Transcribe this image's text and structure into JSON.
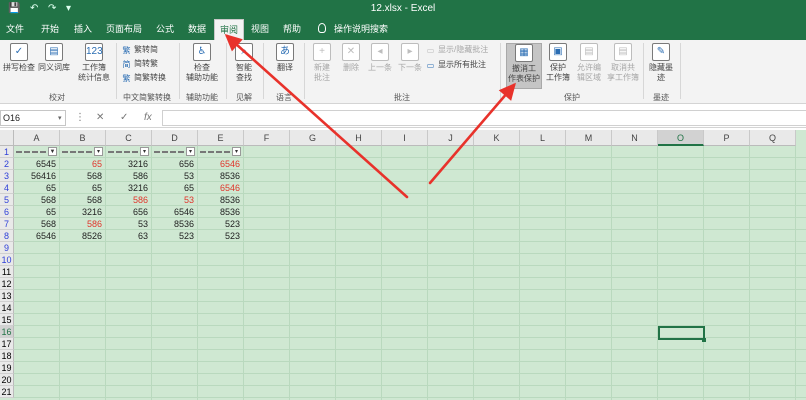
{
  "window": {
    "title": "12.xlsx - Excel",
    "quick_access": [
      "save-icon",
      "undo-icon",
      "redo-icon",
      "customize-icon"
    ],
    "brand_color": "#217346"
  },
  "tabs": [
    {
      "label": "文件"
    },
    {
      "label": "开始"
    },
    {
      "label": "插入"
    },
    {
      "label": "页面布局"
    },
    {
      "label": "公式"
    },
    {
      "label": "数据"
    },
    {
      "label": "审阅",
      "active": true
    },
    {
      "label": "视图"
    },
    {
      "label": "帮助"
    },
    {
      "label": "操作说明搜索"
    }
  ],
  "ribbon": {
    "proofing": {
      "group": "校对",
      "spelling": "拼写检查",
      "thesaurus": "同义词库",
      "stats_line1": "工作簿",
      "stats_line2": "统计信息"
    },
    "chinese": {
      "group": "中文简繁转换",
      "to_simplified": "繁转简",
      "to_traditional": "简转繁",
      "convert": "简繁转换"
    },
    "accessibility": {
      "group": "辅助功能",
      "check_line1": "检查",
      "check_line2": "辅助功能"
    },
    "insights": {
      "group": "见解",
      "smart_line1": "智能",
      "smart_line2": "查找"
    },
    "language": {
      "group": "语言",
      "translate": "翻译"
    },
    "comments": {
      "group": "批注",
      "new_line1": "新建",
      "new_line2": "批注",
      "delete": "删除",
      "previous": "上一条",
      "next": "下一条",
      "show_hide": "显示/隐藏批注",
      "show_all": "显示所有批注"
    },
    "protect": {
      "group": "保护",
      "unprotect_line1": "撤消工",
      "unprotect_line2": "作表保护",
      "protect_wb_line1": "保护",
      "protect_wb_line2": "工作簿",
      "allow_line1": "允许编",
      "allow_line2": "辑区域",
      "unshare_line1": "取消共",
      "unshare_line2": "享工作簿"
    },
    "ink": {
      "group": "墨迹",
      "hide_line1": "隐藏墨",
      "hide_line2": "迹"
    }
  },
  "formula_bar": {
    "name_box": "O16",
    "cancel": "✕",
    "enter": "✓",
    "fx": "fx",
    "value": ""
  },
  "sheet": {
    "columns": [
      "A",
      "B",
      "C",
      "D",
      "E",
      "F",
      "G",
      "H",
      "I",
      "J",
      "K",
      "L",
      "M",
      "N",
      "O",
      "P",
      "Q"
    ],
    "selected_column": "O",
    "rows": [
      "1",
      "2",
      "3",
      "4",
      "5",
      "6",
      "7",
      "8",
      "9",
      "10",
      "11",
      "12",
      "13",
      "14",
      "15",
      "16",
      "17",
      "18",
      "19",
      "20",
      "21"
    ],
    "highlighted_rows": [
      "1",
      "2",
      "3",
      "4",
      "5",
      "6",
      "7",
      "8",
      "9",
      "10"
    ],
    "selected_row": "16",
    "selected_cell": "O16",
    "data": [
      [
        {
          "v": "6545"
        },
        {
          "v": "65",
          "red": true
        },
        {
          "v": "3216"
        },
        {
          "v": "656"
        },
        {
          "v": "6546",
          "red": true
        }
      ],
      [
        {
          "v": "56416"
        },
        {
          "v": "568"
        },
        {
          "v": "586"
        },
        {
          "v": "53"
        },
        {
          "v": "8536"
        }
      ],
      [
        {
          "v": "65"
        },
        {
          "v": "65"
        },
        {
          "v": "3216"
        },
        {
          "v": "65"
        },
        {
          "v": "6546",
          "red": true
        }
      ],
      [
        {
          "v": "568"
        },
        {
          "v": "568"
        },
        {
          "v": "586",
          "red": true
        },
        {
          "v": "53",
          "red": true
        },
        {
          "v": "8536"
        }
      ],
      [
        {
          "v": "65"
        },
        {
          "v": "3216"
        },
        {
          "v": "656"
        },
        {
          "v": "6546"
        },
        {
          "v": "8536"
        }
      ],
      [
        {
          "v": "568"
        },
        {
          "v": "586",
          "red": true
        },
        {
          "v": "53"
        },
        {
          "v": "8536"
        },
        {
          "v": "523"
        }
      ],
      [
        {
          "v": "6546"
        },
        {
          "v": "8526"
        },
        {
          "v": "63"
        },
        {
          "v": "523"
        },
        {
          "v": "523"
        }
      ]
    ],
    "text_red": "#e0352b",
    "sheet_bg": "#cfe8d2"
  },
  "annotations": {
    "arrow_color": "#e8322b"
  }
}
